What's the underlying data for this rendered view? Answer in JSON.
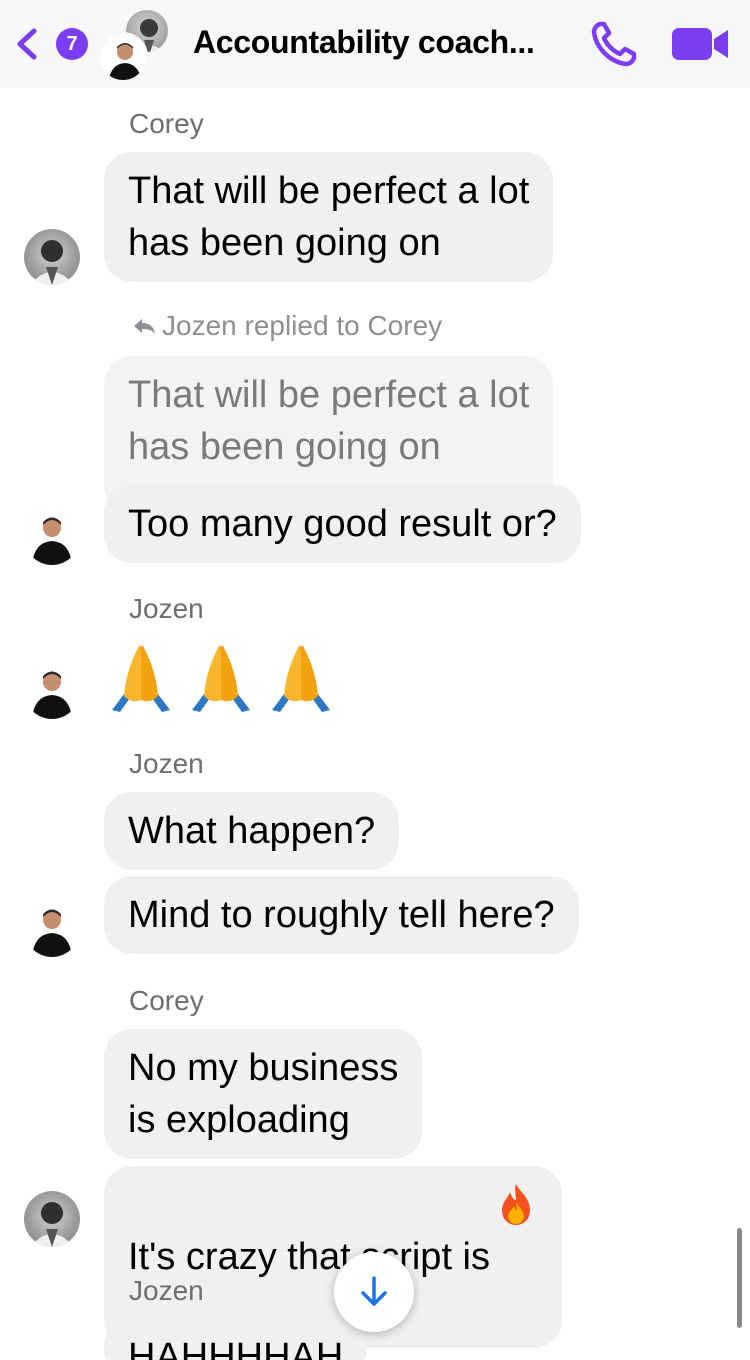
{
  "header": {
    "unread_count": "7",
    "title": "Accountability coach..."
  },
  "colors": {
    "accent": "#7b3df2",
    "bubble": "#f0f0f0",
    "sender_name": "#6d6d72"
  },
  "icons": {
    "back": "chevron-left-icon",
    "call": "phone-icon",
    "video": "video-camera-icon",
    "reply": "reply-arrow-icon",
    "scroll": "arrow-down-icon",
    "emoji_pray": "folded-hands-icon",
    "emoji_fire": "fire-icon"
  },
  "messages": {
    "m1": {
      "sender": "Corey",
      "text": "That will be perfect a lot\nhas been going on"
    },
    "m2": {
      "reply_label": "Jozen replied to Corey",
      "quoted_text": "That will be perfect a lot\nhas been going on",
      "text": "Too many good result or?"
    },
    "m3": {
      "sender": "Jozen"
    },
    "m4": {
      "sender": "Jozen",
      "text_1": "What happen?",
      "text_2": "Mind to roughly tell here?"
    },
    "m5": {
      "sender": "Corey",
      "text_1": "No my business\nis exploading",
      "text_2": "It's crazy that script is"
    },
    "m6": {
      "sender": "Jozen",
      "text_partial": "HAHHHHAH"
    }
  }
}
